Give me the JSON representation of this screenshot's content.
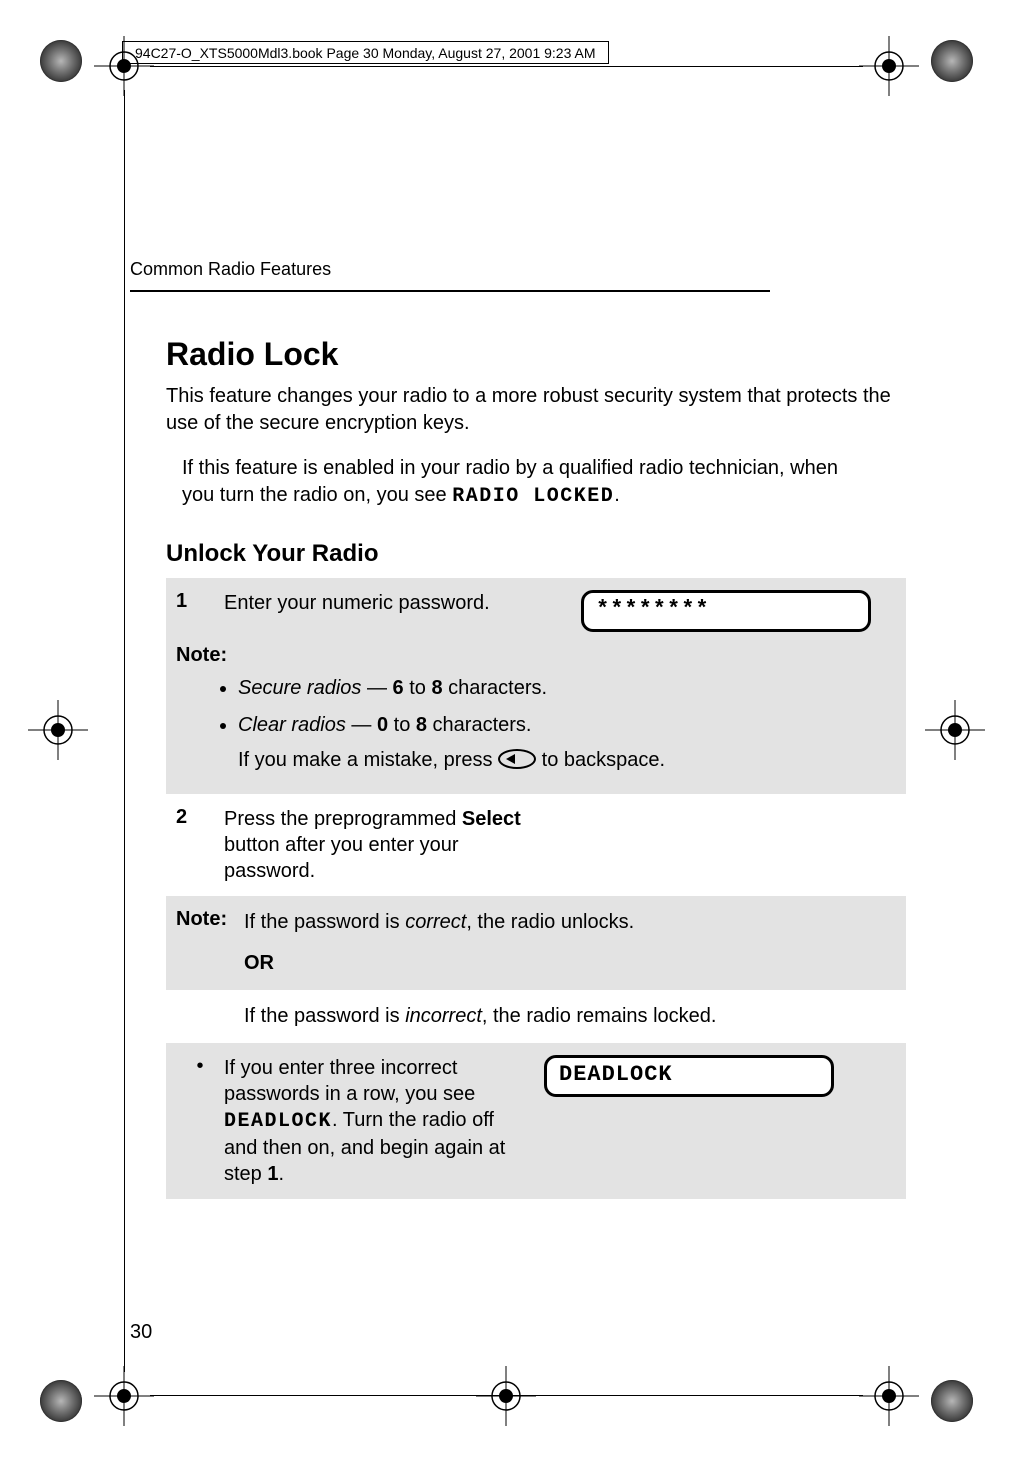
{
  "header_strip": "94C27-O_XTS5000Mdl3.book  Page 30  Monday, August 27, 2001  9:23 AM",
  "running_head": "Common Radio Features",
  "title": "Radio Lock",
  "intro": "This feature changes your radio to a more robust security system that protects the use of the secure encryption keys.",
  "sub_intro_pre": "If this feature is enabled in your radio by a qualified radio technician, when you turn the radio on, you see ",
  "sub_intro_code": "RADIO LOCKED",
  "subtitle": "Unlock Your Radio",
  "step1_num": "1",
  "step1_text": "Enter your numeric password.",
  "step1_display": "********",
  "note_label": "Note:",
  "bullet1_pre": "Secure radios",
  "bullet1_mid1": " — ",
  "bullet1_b1": "6",
  "bullet1_mid2": " to ",
  "bullet1_b2": "8",
  "bullet1_post": " characters.",
  "bullet2_pre": "Clear radios",
  "bullet2_mid1": " — ",
  "bullet2_b1": "0",
  "bullet2_mid2": " to ",
  "bullet2_b2": "8",
  "bullet2_post": " characters.",
  "bullet2_line2_pre": "If you make a mistake, press ",
  "bullet2_line2_post": " to backspace.",
  "step2_num": "2",
  "step2_text_pre": "Press the preprogrammed ",
  "step2_text_bold": "Select",
  "step2_text_post": " button after you enter your password.",
  "note2_label": "Note:",
  "note2_a_pre": "If the password is ",
  "note2_a_em": "correct",
  "note2_a_post": ", the radio unlocks.",
  "note2_or": "OR",
  "note2_b_pre": "If the password is ",
  "note2_b_em": "incorrect",
  "note2_b_post": ", the radio remains locked.",
  "final_bullet_pre": "If you enter three incorrect passwords in a row, you see ",
  "final_bullet_code": "DEADLOCK",
  "final_bullet_mid": ". Turn the radio off and then on, and begin again at step ",
  "final_bullet_num": "1",
  "final_bullet_end": ".",
  "final_display": "DEADLOCK",
  "page_number": "30"
}
